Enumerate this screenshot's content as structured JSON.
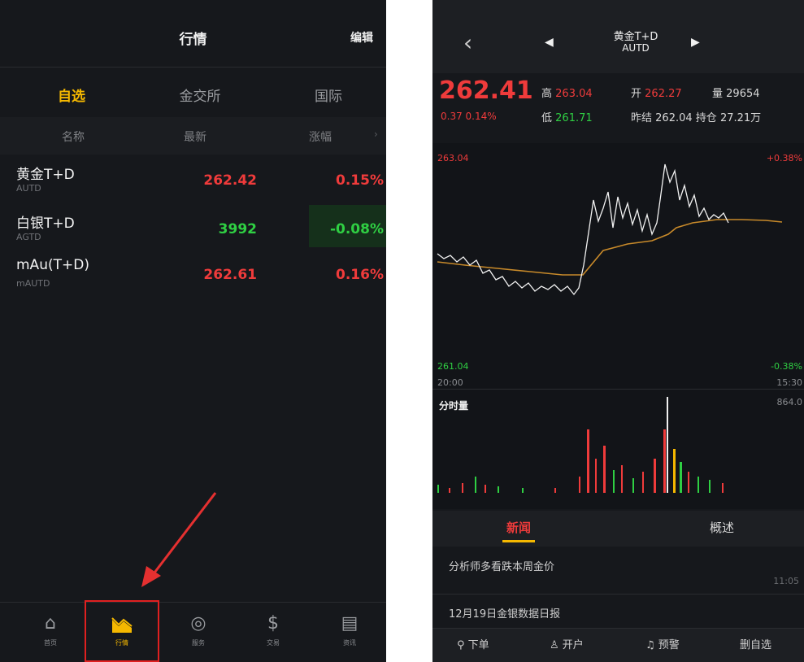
{
  "left": {
    "title": "行情",
    "edit": "编辑",
    "tabs": [
      {
        "label": "自选",
        "active": true
      },
      {
        "label": "金交所",
        "active": false
      },
      {
        "label": "国际",
        "active": false
      }
    ],
    "columns": [
      "名称",
      "最新",
      "涨幅"
    ],
    "rows": [
      {
        "name": "黄金T+D",
        "code": "AUTD",
        "price": "262.42",
        "change": "0.15%",
        "dir": "up"
      },
      {
        "name": "白银T+D",
        "code": "AGTD",
        "price": "3992",
        "change": "-0.08%",
        "dir": "down"
      },
      {
        "name": "mAu(T+D)",
        "code": "mAUTD",
        "price": "262.61",
        "change": "0.16%",
        "dir": "up"
      }
    ],
    "nav": [
      {
        "label": "首页",
        "icon": "home-icon",
        "active": false
      },
      {
        "label": "行情",
        "icon": "chart-icon",
        "active": true
      },
      {
        "label": "服务",
        "icon": "service-icon",
        "active": false
      },
      {
        "label": "交易",
        "icon": "trade-icon",
        "active": false
      },
      {
        "label": "资讯",
        "icon": "news-icon",
        "active": false
      }
    ]
  },
  "right": {
    "header": {
      "name": "黄金T+D",
      "code": "AUTD"
    },
    "quote": {
      "price": "262.41",
      "change": "0.37",
      "change_pct": "0.14%",
      "high_label": "高",
      "high": "263.04",
      "low_label": "低",
      "low": "261.71",
      "open_label": "开",
      "open": "262.27",
      "prev_close_label": "昨结",
      "prev_close": "262.04",
      "volume_label": "量",
      "volume": "29654",
      "position_label": "持仓",
      "position": "27.21万"
    },
    "chart": {
      "y_max": "263.04",
      "y_min": "261.04",
      "pct_max": "+0.38%",
      "pct_min": "-0.38%",
      "time_start": "20:00",
      "time_end": "15:30",
      "volume_title": "分时量",
      "volume_max": "864.0"
    },
    "tabs": [
      {
        "label": "新闻",
        "active": true
      },
      {
        "label": "概述",
        "active": false
      }
    ],
    "news": [
      {
        "title": "分析师多看跌本周金价",
        "time": "11:05"
      },
      {
        "title": "12月19日金银数据日报",
        "time": ""
      }
    ],
    "actions": [
      "下单",
      "开户",
      "预警",
      "删自选"
    ]
  },
  "colors": {
    "up": "#ef3b3b",
    "down": "#2fcf43",
    "accent": "#f5b800",
    "bg": "#16181c",
    "highlight": "#e02020"
  }
}
